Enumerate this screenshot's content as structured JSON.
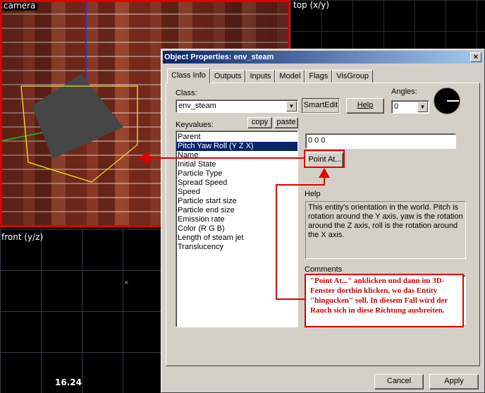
{
  "viewports": {
    "camera_label": "camera",
    "top_label": "top (x/y)",
    "front_label": "front (y/z)",
    "coord_readout": "16.24"
  },
  "dialog": {
    "title": "Object Properties: env_steam",
    "close": "×",
    "tabs": [
      "Class Info",
      "Outputs",
      "Inputs",
      "Model",
      "Flags",
      "VisGroup"
    ],
    "class_label": "Class:",
    "class_value": "env_steam",
    "smartedit": "SmartEdit",
    "help_button": "Help",
    "angles_label": "Angles:",
    "angles_value": "0",
    "keyvalues_label": "Keyvalues:",
    "copy": "copy",
    "paste": "paste",
    "keyvalues": [
      "Parent",
      "Pitch Yaw Roll (Y Z X)",
      "Name",
      "Initial State",
      "Particle Type",
      "Spread Speed",
      "Speed",
      "Particle start size",
      "Particle end size",
      "Emission rate",
      "Color (R G B)",
      "Length of steam jet",
      "Translucency"
    ],
    "selected_index": 1,
    "value_field": "0 0 0",
    "point_at": "Point At...",
    "help_label": "Help",
    "help_text": "This entity's orientation in the world. Pitch is rotation around the Y axis, yaw is the rotation around the Z axis, roll is the rotation around the X axis.",
    "comments_label": "Comments",
    "cancel": "Cancel",
    "apply": "Apply"
  },
  "annotation": {
    "text": "\"Point At...\" anklicken und dann im 3D-Fenster dorthin klicken, wo das Entity \"hingucken\" soll. In diesem Fall wird der Rauch sich in diese Richtung ausbreiten.",
    "color": "#e00000"
  }
}
